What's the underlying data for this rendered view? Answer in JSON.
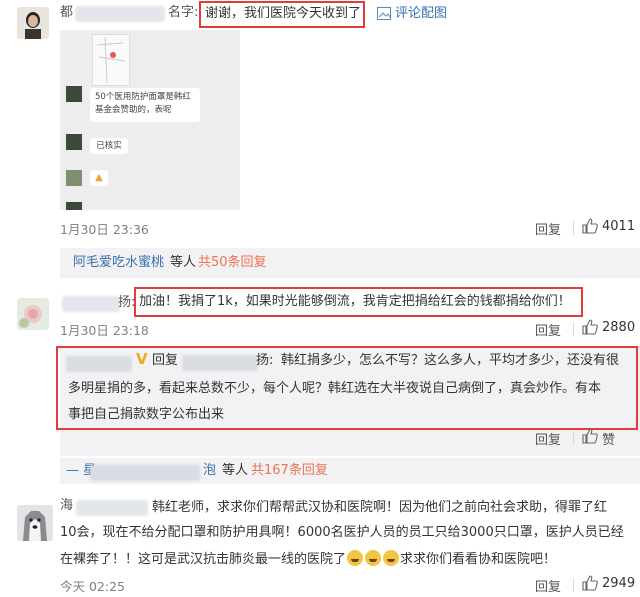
{
  "comment1": {
    "name_prefix": "都",
    "name_suffix": "名字:",
    "highlight_text": "谢谢，我们医院今天收到了",
    "image_link": "评论配图",
    "screenshot": {
      "msg1": "50个医用防护面罩是韩红基金会赞助的，",
      "msg1_tail": "表呢",
      "msg2": "已核实"
    },
    "time": "1月30日 23:36",
    "reply_label": "回复",
    "likes": "4011"
  },
  "thread1": {
    "first_user": "阿毛爱吃水蜜桃",
    "suffix": "等人",
    "count_link": "共50条回复"
  },
  "comment2": {
    "name_tail": "扬:",
    "text": "加油！我捐了1k，如果时光能够倒流，我肯定把捐给红会的钱都捐给你们！",
    "time": "1月30日 23:18",
    "likes": "2880",
    "reply": {
      "reply_prefix": "回复",
      "name_tail": "扬:",
      "line1": "韩红捐多少，怎么不写？这么多人，平均才多少，还没有很",
      "line2": "多明星捐的多，看起来总数不少，每个人呢？韩红选在大半夜说自己病倒了，真会炒作。有本",
      "line3": "事把自己捐款数字公布出来",
      "reply_label": "回复",
      "like_label": "赞"
    }
  },
  "thread2": {
    "prefix": "— 星",
    "mid": "泡",
    "suffix": "等人",
    "count_link": "共167条回复"
  },
  "comment3": {
    "name_first": "海",
    "line1": "韩红老师，求求你们帮帮武汉协和医院啊！因为他们之前向社会求助，得罪了红",
    "line2": "10会，现在不给分配口罩和防护用具啊！6000名医护人员的员工只给3000只口罩，医护人员已经",
    "line3a": "在裸奔了！！这可是武汉抗击肺炎最一线的医院了",
    "line3b": "求求你们看看协和医院吧！",
    "time": "今天 02:25",
    "reply_label": "回复",
    "likes": "2949"
  },
  "colors": {
    "highlight": "#e53b3b",
    "link_orange": "#eb7350",
    "link_blue": "#3a6fb0",
    "meta_gray": "#808080"
  }
}
